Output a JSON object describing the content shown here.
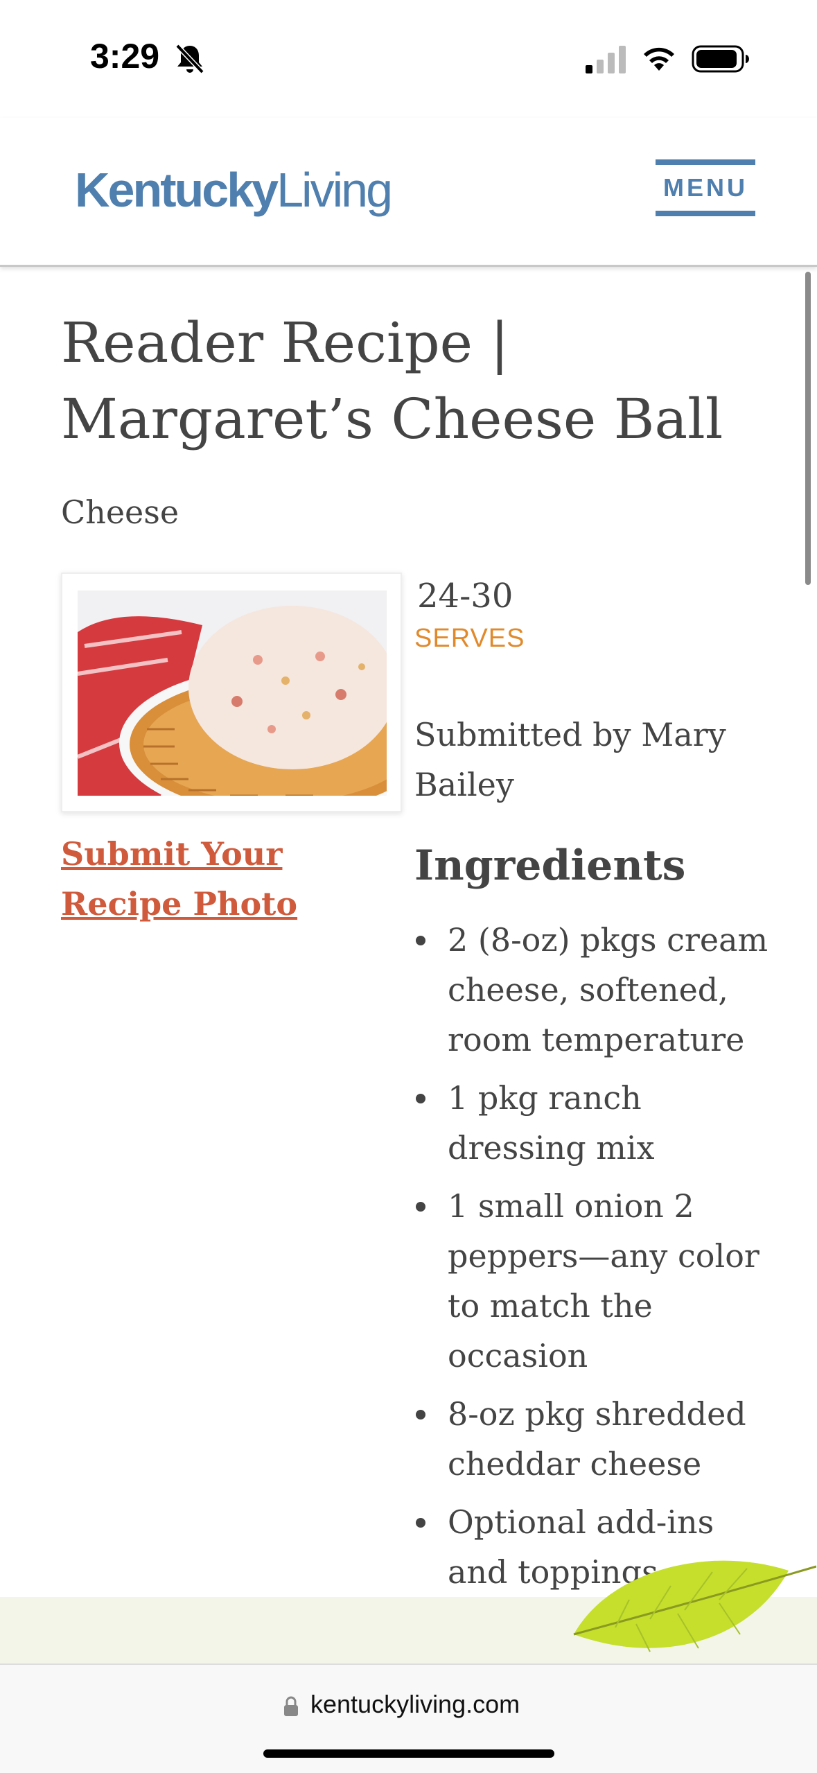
{
  "status_bar": {
    "time": "3:29",
    "icons": [
      "bell-slash-icon",
      "cellular-signal-icon",
      "wifi-icon",
      "battery-icon"
    ]
  },
  "header": {
    "logo_bold": "Kentucky",
    "logo_light": "Living",
    "menu_label": "MENU",
    "brand_color": "#4f7fae"
  },
  "article": {
    "title": "Reader Recipe | Margaret’s Cheese Ball",
    "category": "Cheese",
    "image_icon": "cheese-ball-photo",
    "submit_link": "Submit Your Recipe Photo",
    "serves_value": "24-30",
    "serves_label": "SERVES",
    "submitted_by": "Submitted by Mary Bailey",
    "ingredients_heading": "Ingredients",
    "ingredients": [
      "2 (8-oz) pkgs cream cheese, softened, room temperature",
      "1 pkg ranch dressing mix",
      "1 small onion 2 peppers—any color to match the occasion",
      "8-oz pkg shredded cheddar cheese",
      "Optional add-ins and toppings"
    ],
    "accent_color": "#d05a3c",
    "serves_color": "#e08a2c"
  },
  "browser": {
    "url": "kentuckyliving.com"
  }
}
